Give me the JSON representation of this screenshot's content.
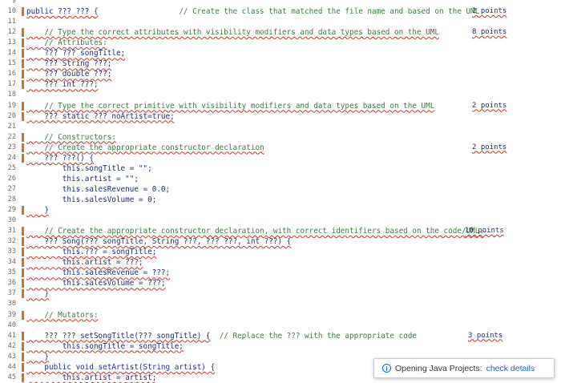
{
  "editor": {
    "lines": [
      {
        "n": "9",
        "segments": [],
        "points": ""
      },
      {
        "n": "10",
        "segments": [
          {
            "t": "public ??? ??? {",
            "c": "kw sq"
          },
          {
            "t": "                  ",
            "c": ""
          },
          {
            "t": "// Create the class that matched the file name and based on the UML",
            "c": "cmt"
          }
        ],
        "points": "2 points"
      },
      {
        "n": "11",
        "segments": [],
        "points": ""
      },
      {
        "n": "12",
        "segments": [
          {
            "t": "    // Type the correct attributes with visibility modifiers and data types based on the UML",
            "c": "cmt sq"
          }
        ],
        "points": "8 points"
      },
      {
        "n": "13",
        "segments": [
          {
            "t": "    // Attributes:",
            "c": "cmt sq"
          }
        ],
        "points": ""
      },
      {
        "n": "14",
        "segments": [
          {
            "t": "    ??? ??? songTitle;",
            "c": "sq"
          }
        ],
        "points": ""
      },
      {
        "n": "15",
        "segments": [
          {
            "t": "    ??? String ???;",
            "c": "sq"
          }
        ],
        "points": ""
      },
      {
        "n": "16",
        "segments": [
          {
            "t": "    ??? double ???;",
            "c": "sq"
          }
        ],
        "points": ""
      },
      {
        "n": "17",
        "segments": [
          {
            "t": "    ??? int ???;",
            "c": "sq"
          }
        ],
        "points": ""
      },
      {
        "n": "18",
        "segments": [],
        "points": ""
      },
      {
        "n": "19",
        "segments": [
          {
            "t": "    // Type the correct primitive with visibility modifiers and data types based on the UML",
            "c": "cmt sq"
          }
        ],
        "points": "2 points"
      },
      {
        "n": "20",
        "segments": [
          {
            "t": "    ??? static ??? noArtist=true;",
            "c": "sq"
          }
        ],
        "points": ""
      },
      {
        "n": "21",
        "segments": [],
        "points": ""
      },
      {
        "n": "22",
        "segments": [
          {
            "t": "    // Constructors:",
            "c": "cmt sq"
          }
        ],
        "points": ""
      },
      {
        "n": "23",
        "segments": [
          {
            "t": "    // Create the appropriate constructor declaration",
            "c": "cmt sq"
          }
        ],
        "points": "2 points"
      },
      {
        "n": "24",
        "segments": [
          {
            "t": "    ??? ???() {",
            "c": "sq"
          }
        ],
        "points": ""
      },
      {
        "n": "25",
        "segments": [
          {
            "t": "        this.songTitle = \"\";",
            "c": ""
          }
        ],
        "points": ""
      },
      {
        "n": "26",
        "segments": [
          {
            "t": "        this.artist = \"\";",
            "c": ""
          }
        ],
        "points": ""
      },
      {
        "n": "27",
        "segments": [
          {
            "t": "        this.salesRevenue = 0.0;",
            "c": ""
          }
        ],
        "points": ""
      },
      {
        "n": "28",
        "segments": [
          {
            "t": "        this.salesVolume = 0;",
            "c": ""
          }
        ],
        "points": ""
      },
      {
        "n": "29",
        "segments": [
          {
            "t": "    }",
            "c": "sq"
          }
        ],
        "points": ""
      },
      {
        "n": "30",
        "segments": [],
        "points": ""
      },
      {
        "n": "31",
        "segments": [
          {
            "t": "    // Create the appropriate constructor declaration, with correct identifiers based on the code/UML.",
            "c": "cmt sq"
          }
        ],
        "points": "10 points"
      },
      {
        "n": "32",
        "segments": [
          {
            "t": "    ??? Song(??? songTitle, String ???, ??? ???, int ???) {",
            "c": "sq"
          }
        ],
        "points": ""
      },
      {
        "n": "33",
        "segments": [
          {
            "t": "        this.??? = songTitle;",
            "c": "sq"
          }
        ],
        "points": ""
      },
      {
        "n": "34",
        "segments": [
          {
            "t": "        this.artist = ???;",
            "c": "sq"
          }
        ],
        "points": ""
      },
      {
        "n": "35",
        "segments": [
          {
            "t": "        this.salesRevenue = ???;",
            "c": "sq"
          }
        ],
        "points": ""
      },
      {
        "n": "36",
        "segments": [
          {
            "t": "        this.salesVolume = ???;",
            "c": "sq"
          }
        ],
        "points": ""
      },
      {
        "n": "37",
        "segments": [
          {
            "t": "    }",
            "c": "sq"
          }
        ],
        "points": ""
      },
      {
        "n": "38",
        "segments": [],
        "points": ""
      },
      {
        "n": "39",
        "segments": [
          {
            "t": "    // Mutators:",
            "c": "cmt sq"
          }
        ],
        "points": ""
      },
      {
        "n": "40",
        "segments": [],
        "points": ""
      },
      {
        "n": "41",
        "segments": [
          {
            "t": "    ??? ??? setSongTitle(??? songTitle) {",
            "c": "sq"
          },
          {
            "t": "  // Replace the ??? with the appropriate code",
            "c": "cmt"
          }
        ],
        "points": "3 points"
      },
      {
        "n": "42",
        "segments": [
          {
            "t": "        this.songTitle = songTitle;",
            "c": "sq"
          }
        ],
        "points": ""
      },
      {
        "n": "43",
        "segments": [
          {
            "t": "    }",
            "c": "sq"
          }
        ],
        "points": ""
      },
      {
        "n": "44",
        "segments": [
          {
            "t": "    public void setArtist(String artist) {",
            "c": "kw sq"
          }
        ],
        "points": ""
      },
      {
        "n": "45",
        "segments": [
          {
            "t": "        this.artist = artist;",
            "c": "sq"
          }
        ],
        "points": ""
      }
    ]
  },
  "notification": {
    "message": "Opening Java Projects:",
    "link": "check details",
    "icon": "info-icon"
  },
  "colors": {
    "comment": "#3d7a3d",
    "keyword": "#1e2d8c",
    "squiggle": "#c0392b",
    "link": "#1e63b8"
  }
}
